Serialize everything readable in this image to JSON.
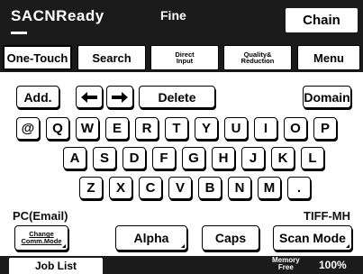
{
  "header": {
    "status_title": "SACNReady",
    "quality": "Fine",
    "chain_label": "Chain"
  },
  "tabs": [
    {
      "label": "One-Touch",
      "active": true
    },
    {
      "label": "Search",
      "active": false
    },
    {
      "label": "Direct Input",
      "line1": "Direct",
      "line2": "Input",
      "active": false
    },
    {
      "label": "Quality& Reduction",
      "line1": "Quality&",
      "line2": "Reduction",
      "active": false
    },
    {
      "label": "Menu",
      "active": false
    }
  ],
  "keyboard": {
    "add_label": "Add.",
    "left_icon": "left-arrow-icon",
    "right_icon": "right-arrow-icon",
    "delete_label": "Delete",
    "domain_label": "Domain",
    "row1": [
      "@",
      "Q",
      "W",
      "E",
      "R",
      "T",
      "Y",
      "U",
      "I",
      "O",
      "P"
    ],
    "row2": [
      "A",
      "S",
      "D",
      "F",
      "G",
      "H",
      "J",
      "K",
      "L"
    ],
    "row3": [
      "Z",
      "X",
      "C",
      "V",
      "B",
      "N",
      "M",
      "."
    ]
  },
  "mode_label": "PC(Email)",
  "format_label": "TIFF-MH",
  "bottom_buttons": {
    "change_line1": "Change",
    "change_line2": "Comm.Mode",
    "alpha": "Alpha",
    "caps": "Caps",
    "scan_mode": "Scan Mode"
  },
  "status": {
    "job_list": "Job List",
    "memory_line1": "Memory",
    "memory_line2": "Free",
    "memory_percent": "100%"
  }
}
